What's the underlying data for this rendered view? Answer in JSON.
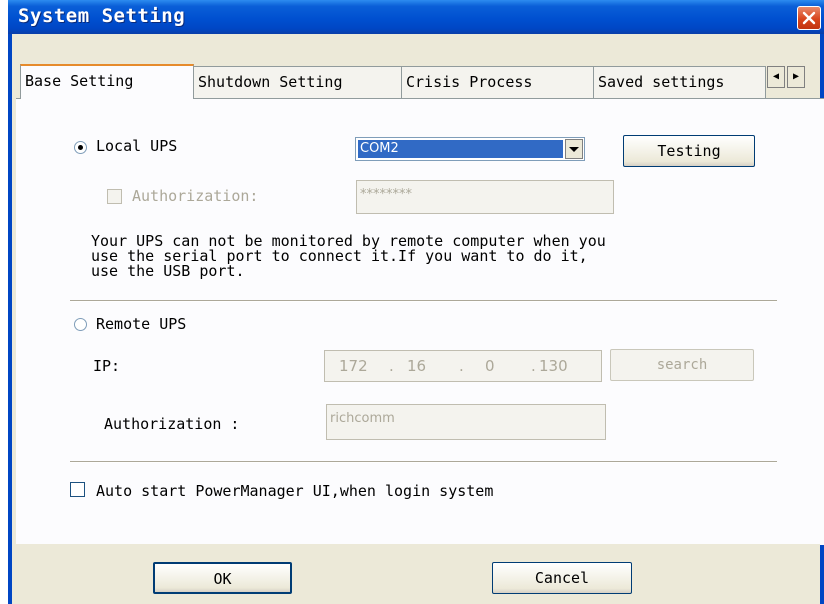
{
  "window": {
    "title": "System Setting"
  },
  "tabs": [
    {
      "label": "Base Setting"
    },
    {
      "label": "Shutdown Setting"
    },
    {
      "label": "Crisis Process"
    },
    {
      "label": "Saved settings"
    }
  ],
  "local_ups": {
    "label": "Local UPS",
    "selected": true,
    "port": "COM2",
    "testing_label": "Testing",
    "authorization_label": "Authorization:",
    "authorization_value": "********",
    "authorization_checked": false
  },
  "note": {
    "line1": "Your UPS can not be monitored by remote computer when you",
    "line2": "use the serial port to connect it.If you want to do it,",
    "line3": "use the USB port."
  },
  "remote_ups": {
    "label": "Remote UPS",
    "selected": false,
    "ip_label": "IP:",
    "ip": [
      "172",
      "16",
      "0",
      "130"
    ],
    "search_label": "search",
    "authorization_label": "Authorization :",
    "authorization_value": "richcomm"
  },
  "auto_start": {
    "label": "Auto start PowerManager UI,when login system",
    "checked": false
  },
  "buttons": {
    "ok": "OK",
    "cancel": "Cancel"
  }
}
